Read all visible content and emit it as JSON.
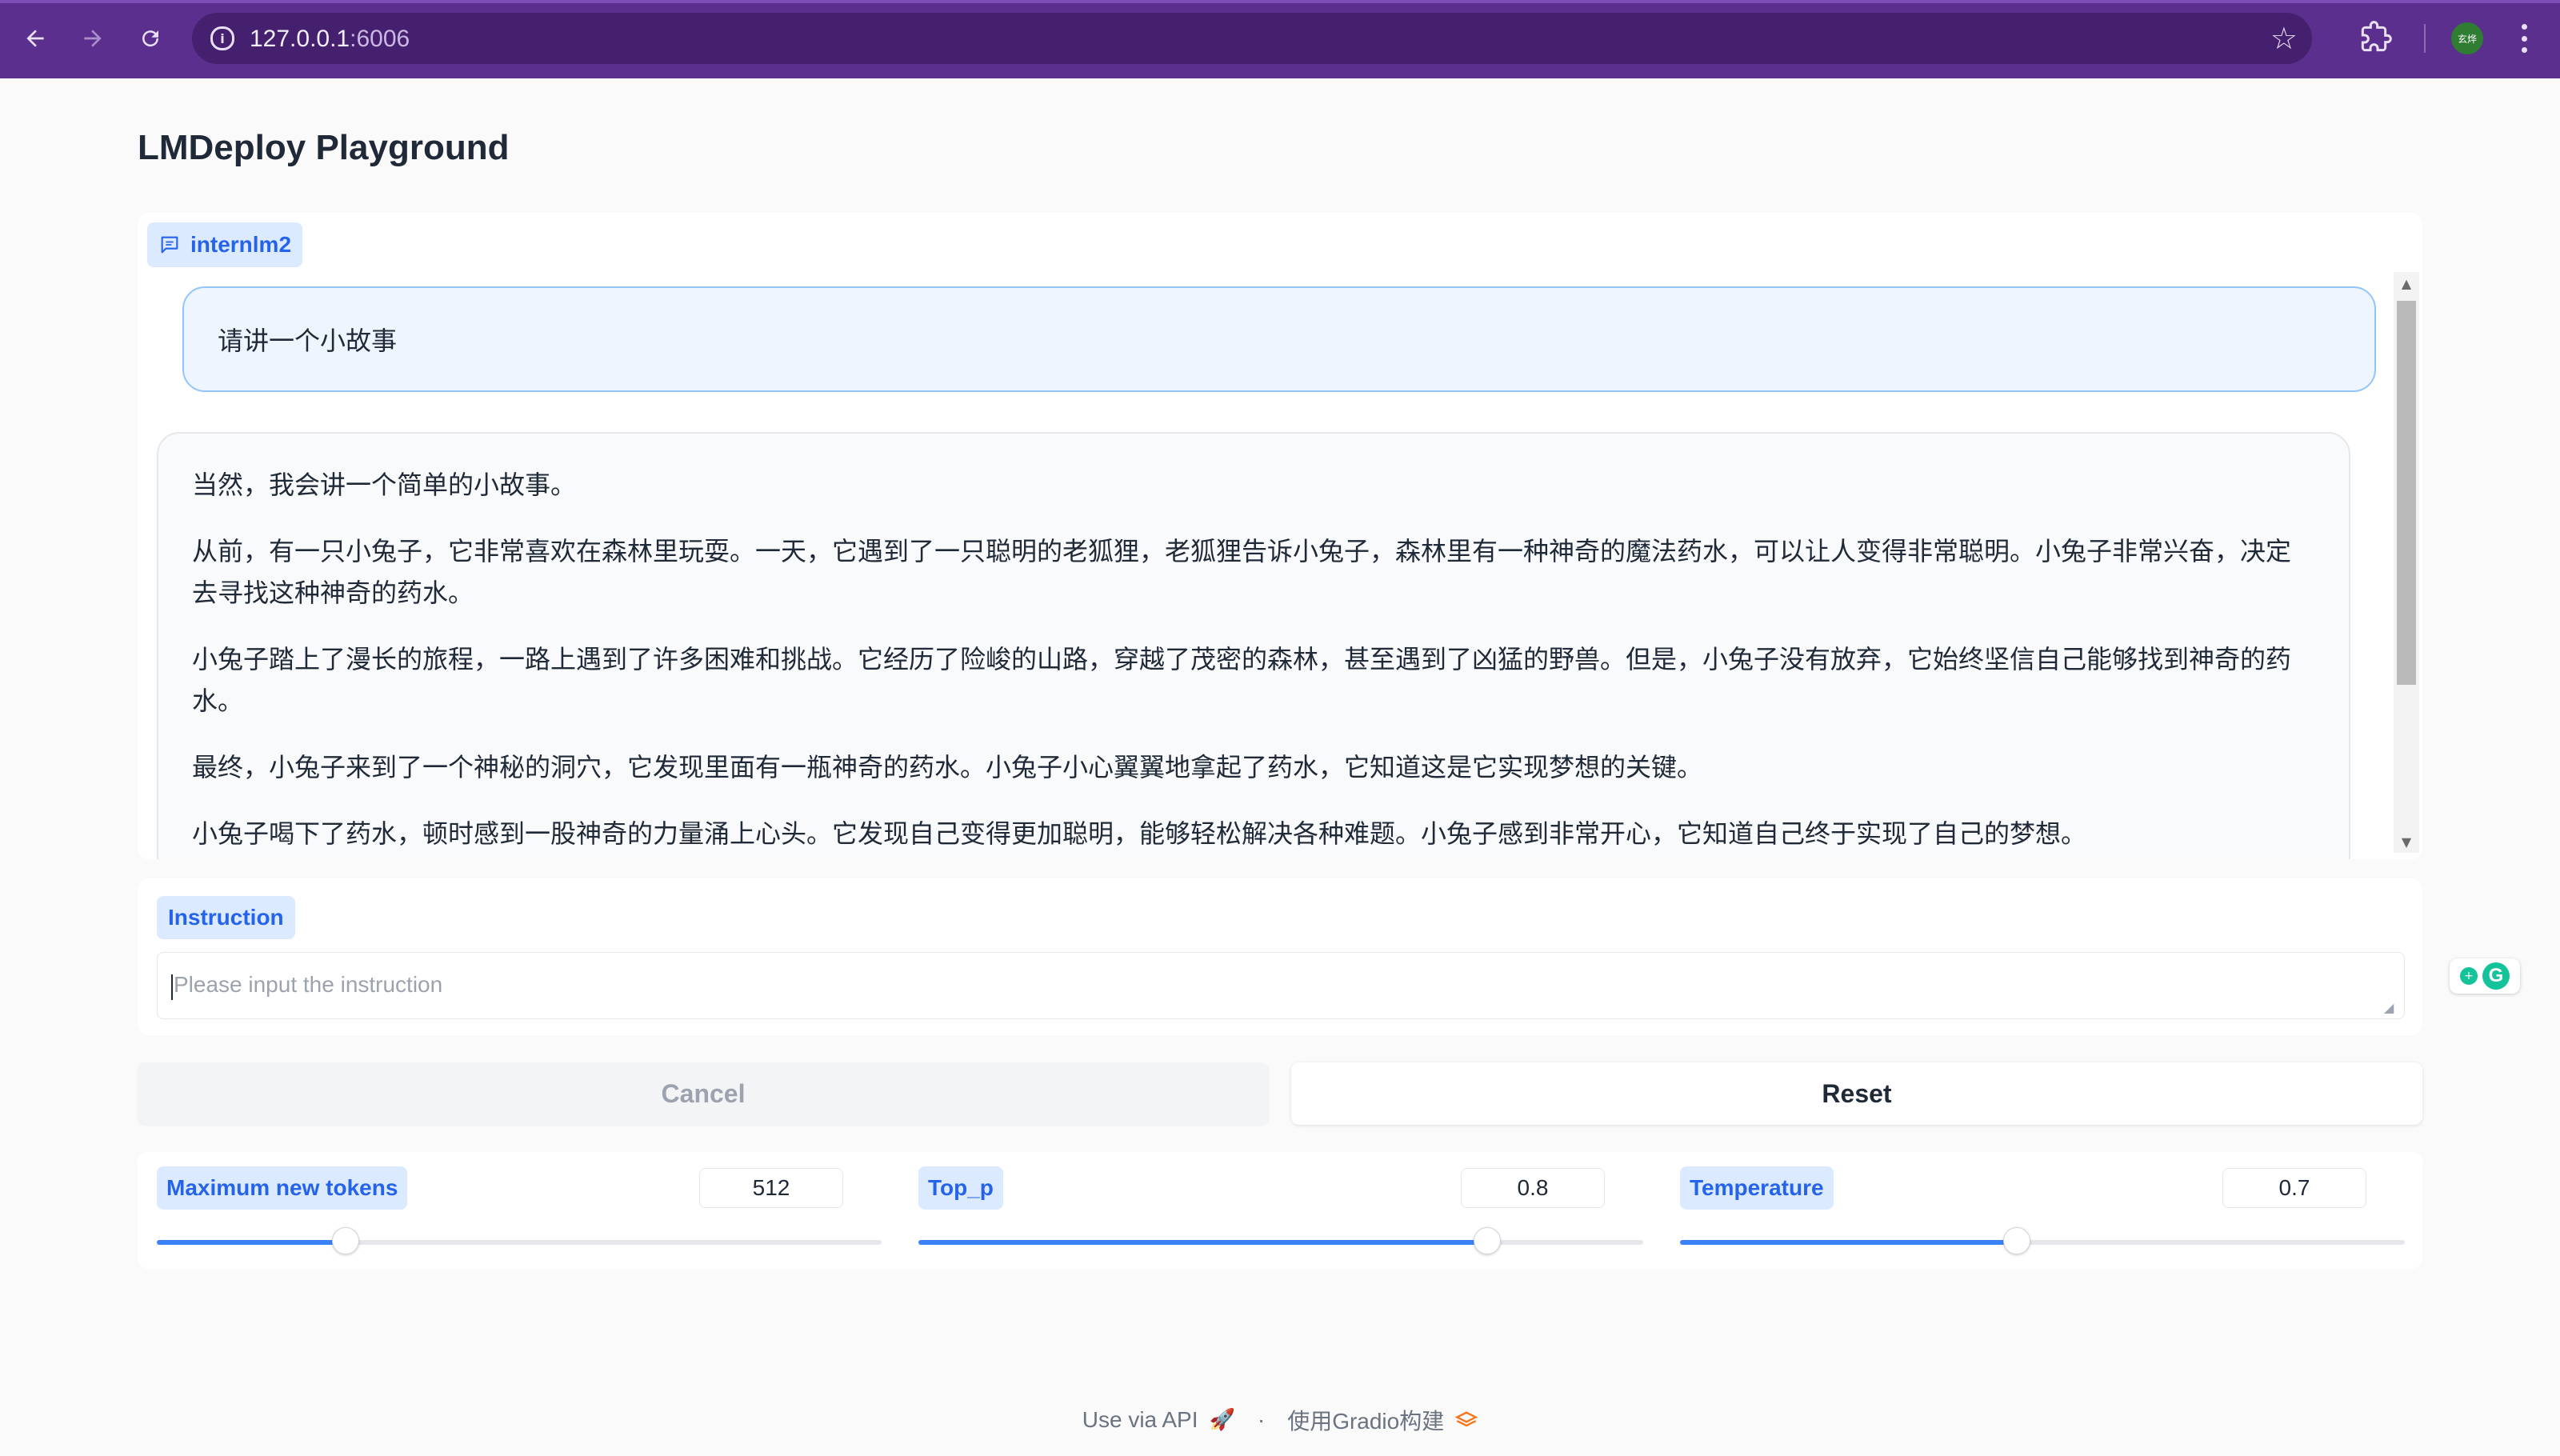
{
  "browser": {
    "url_host": "127.0.0.1",
    "url_port": ":6006",
    "profile_label": "玄烨",
    "accent_color": "#5a2f8e"
  },
  "page": {
    "title": "LMDeploy Playground"
  },
  "chat": {
    "label": "internlm2",
    "messages": [
      {
        "role": "user",
        "text": "请讲一个小故事"
      },
      {
        "role": "assistant",
        "paragraphs": [
          "当然，我会讲一个简单的小故事。",
          "从前，有一只小兔子，它非常喜欢在森林里玩耍。一天，它遇到了一只聪明的老狐狸，老狐狸告诉小兔子，森林里有一种神奇的魔法药水，可以让人变得非常聪明。小兔子非常兴奋，决定去寻找这种神奇的药水。",
          "小兔子踏上了漫长的旅程，一路上遇到了许多困难和挑战。它经历了险峻的山路，穿越了茂密的森林，甚至遇到了凶猛的野兽。但是，小兔子没有放弃，它始终坚信自己能够找到神奇的药水。",
          "最终，小兔子来到了一个神秘的洞穴，它发现里面有一瓶神奇的药水。小兔子小心翼翼地拿起了药水，它知道这是它实现梦想的关键。",
          "小兔子喝下了药水，顿时感到一股神奇的力量涌上心头。它发现自己变得更加聪明，能够轻松解决各种难题。小兔子感到非常开心，它知道自己终于实现了自己的梦想。"
        ]
      }
    ]
  },
  "instruction": {
    "label": "Instruction",
    "placeholder": "Please input the instruction",
    "value": ""
  },
  "buttons": {
    "cancel": "Cancel",
    "reset": "Reset"
  },
  "params": [
    {
      "label": "Maximum new tokens",
      "value": "512",
      "fraction": 0.26
    },
    {
      "label": "Top_p",
      "value": "0.8",
      "fraction": 0.785
    },
    {
      "label": "Temperature",
      "value": "0.7",
      "fraction": 0.465
    }
  ],
  "footer": {
    "api_text": "Use via API",
    "separator": "·",
    "built_with": "使用Gradio构建"
  },
  "colors": {
    "label_bg": "#dbeafe",
    "label_text": "#2563eb",
    "slider_fill": "#3b82f6",
    "user_bubble_border": "#93c5fd"
  }
}
